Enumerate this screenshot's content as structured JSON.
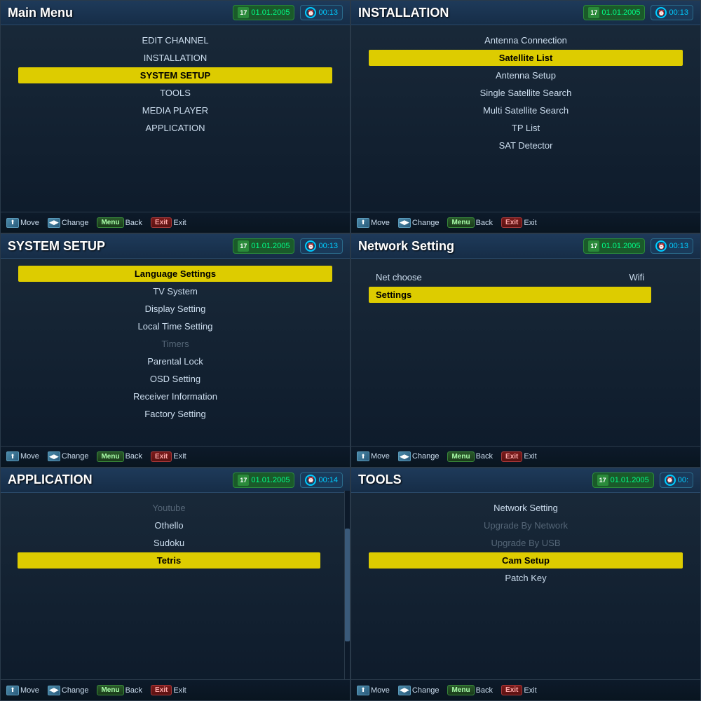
{
  "panels": {
    "main_menu": {
      "title": "Main Menu",
      "date": "01.01.2005",
      "time": "00:13",
      "items": [
        {
          "label": "EDIT CHANNEL",
          "selected": false,
          "disabled": false
        },
        {
          "label": "INSTALLATION",
          "selected": false,
          "disabled": false
        },
        {
          "label": "SYSTEM SETUP",
          "selected": true,
          "disabled": false
        },
        {
          "label": "TOOLS",
          "selected": false,
          "disabled": false
        },
        {
          "label": "MEDIA PLAYER",
          "selected": false,
          "disabled": false
        },
        {
          "label": "APPLICATION",
          "selected": false,
          "disabled": false
        }
      ]
    },
    "installation": {
      "title": "INSTALLATION",
      "date": "01.01.2005",
      "time": "00:13",
      "items": [
        {
          "label": "Antenna Connection",
          "selected": false,
          "disabled": false
        },
        {
          "label": "Satellite List",
          "selected": true,
          "disabled": false
        },
        {
          "label": "Antenna Setup",
          "selected": false,
          "disabled": false
        },
        {
          "label": "Single Satellite Search",
          "selected": false,
          "disabled": false
        },
        {
          "label": "Multi Satellite Search",
          "selected": false,
          "disabled": false
        },
        {
          "label": "TP List",
          "selected": false,
          "disabled": false
        },
        {
          "label": "SAT Detector",
          "selected": false,
          "disabled": false
        }
      ]
    },
    "system_setup": {
      "title": "SYSTEM SETUP",
      "date": "01.01.2005",
      "time": "00:13",
      "items": [
        {
          "label": "Language Settings",
          "selected": true,
          "disabled": false
        },
        {
          "label": "TV System",
          "selected": false,
          "disabled": false
        },
        {
          "label": "Display Setting",
          "selected": false,
          "disabled": false
        },
        {
          "label": "Local Time Setting",
          "selected": false,
          "disabled": false
        },
        {
          "label": "Timers",
          "selected": false,
          "disabled": true
        },
        {
          "label": "Parental Lock",
          "selected": false,
          "disabled": false
        },
        {
          "label": "OSD Setting",
          "selected": false,
          "disabled": false
        },
        {
          "label": "Receiver Information",
          "selected": false,
          "disabled": false
        },
        {
          "label": "Factory Setting",
          "selected": false,
          "disabled": false
        }
      ]
    },
    "network_setting": {
      "title": "Network Setting",
      "date": "01.01.2005",
      "time": "00:13",
      "net_choose_label": "Net choose",
      "net_choose_value": "Wifi",
      "settings_label": "Settings",
      "settings_selected": true
    },
    "application": {
      "title": "APPLICATION",
      "date": "01.01.2005",
      "time": "00:14",
      "items": [
        {
          "label": "Youtube",
          "selected": false,
          "disabled": true
        },
        {
          "label": "Othello",
          "selected": false,
          "disabled": false
        },
        {
          "label": "Sudoku",
          "selected": false,
          "disabled": false
        },
        {
          "label": "Tetris",
          "selected": true,
          "disabled": false
        }
      ]
    },
    "tools": {
      "title": "TOOLS",
      "date": "01.01.2005",
      "time": "00:",
      "items": [
        {
          "label": "Network Setting",
          "selected": false,
          "disabled": false
        },
        {
          "label": "Upgrade By Network",
          "selected": false,
          "disabled": true
        },
        {
          "label": "Upgrade By USB",
          "selected": false,
          "disabled": true
        },
        {
          "label": "Cam Setup",
          "selected": true,
          "disabled": false
        },
        {
          "label": "Patch Key",
          "selected": false,
          "disabled": false
        }
      ]
    }
  },
  "footer": {
    "move_label": "Move",
    "change_label": "Change",
    "back_label": "Back",
    "exit_label": "Exit",
    "menu_key": "Menu",
    "exit_key": "Exit"
  }
}
